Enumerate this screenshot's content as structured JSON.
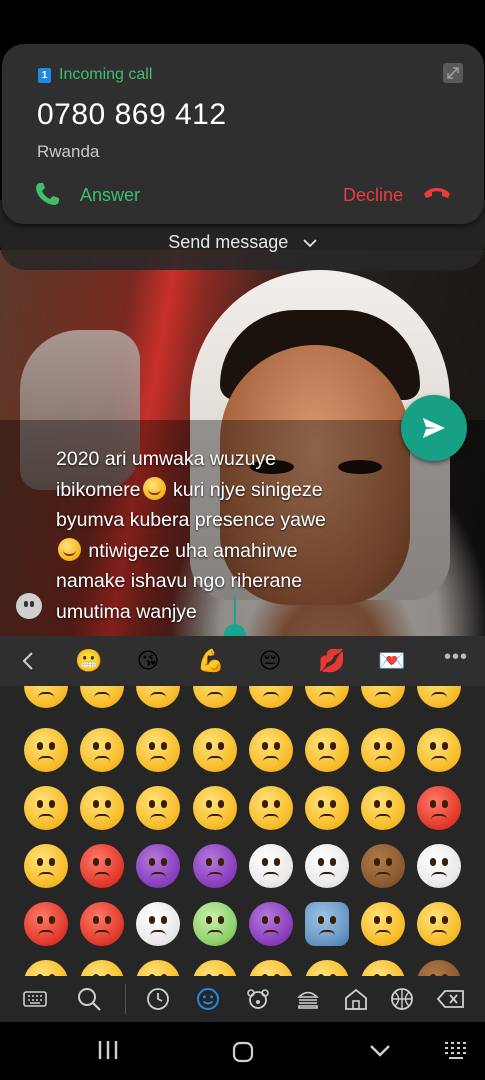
{
  "call": {
    "sim": "1",
    "label": "Incoming call",
    "number": "0780 869 412",
    "country": "Rwanda",
    "answer_label": "Answer",
    "decline_label": "Decline",
    "send_message_label": "Send message"
  },
  "compose": {
    "line1": "2020 ari umwaka wuzuye",
    "line2a": "ibikomere",
    "line2b": " kuri njye sinigeze",
    "line3": "byumva kubera presence yawe",
    "line4": " ntiwigeze uha amahirwe",
    "line5": "namake ishavu ngo riherane",
    "line6": "umutima wanjye"
  },
  "keyboard": {
    "recent": [
      {
        "name": "grimacing-face",
        "glyph": "😬"
      },
      {
        "name": "kissing-face",
        "glyph": "😘"
      },
      {
        "name": "flexed-biceps",
        "glyph": "💪"
      },
      {
        "name": "pensive-face",
        "glyph": "😔"
      },
      {
        "name": "kiss-mark",
        "glyph": "💋"
      },
      {
        "name": "love-letter",
        "glyph": "💌"
      }
    ],
    "categories": [
      "keyboard",
      "search",
      "recent",
      "smileys",
      "animals",
      "food",
      "travel",
      "activities",
      "backspace"
    ],
    "active_category": "smileys"
  },
  "colors": {
    "accent": "#17a085",
    "answer": "#3fbf6a",
    "decline": "#ef3b3b",
    "active_category": "#1e88e5"
  }
}
